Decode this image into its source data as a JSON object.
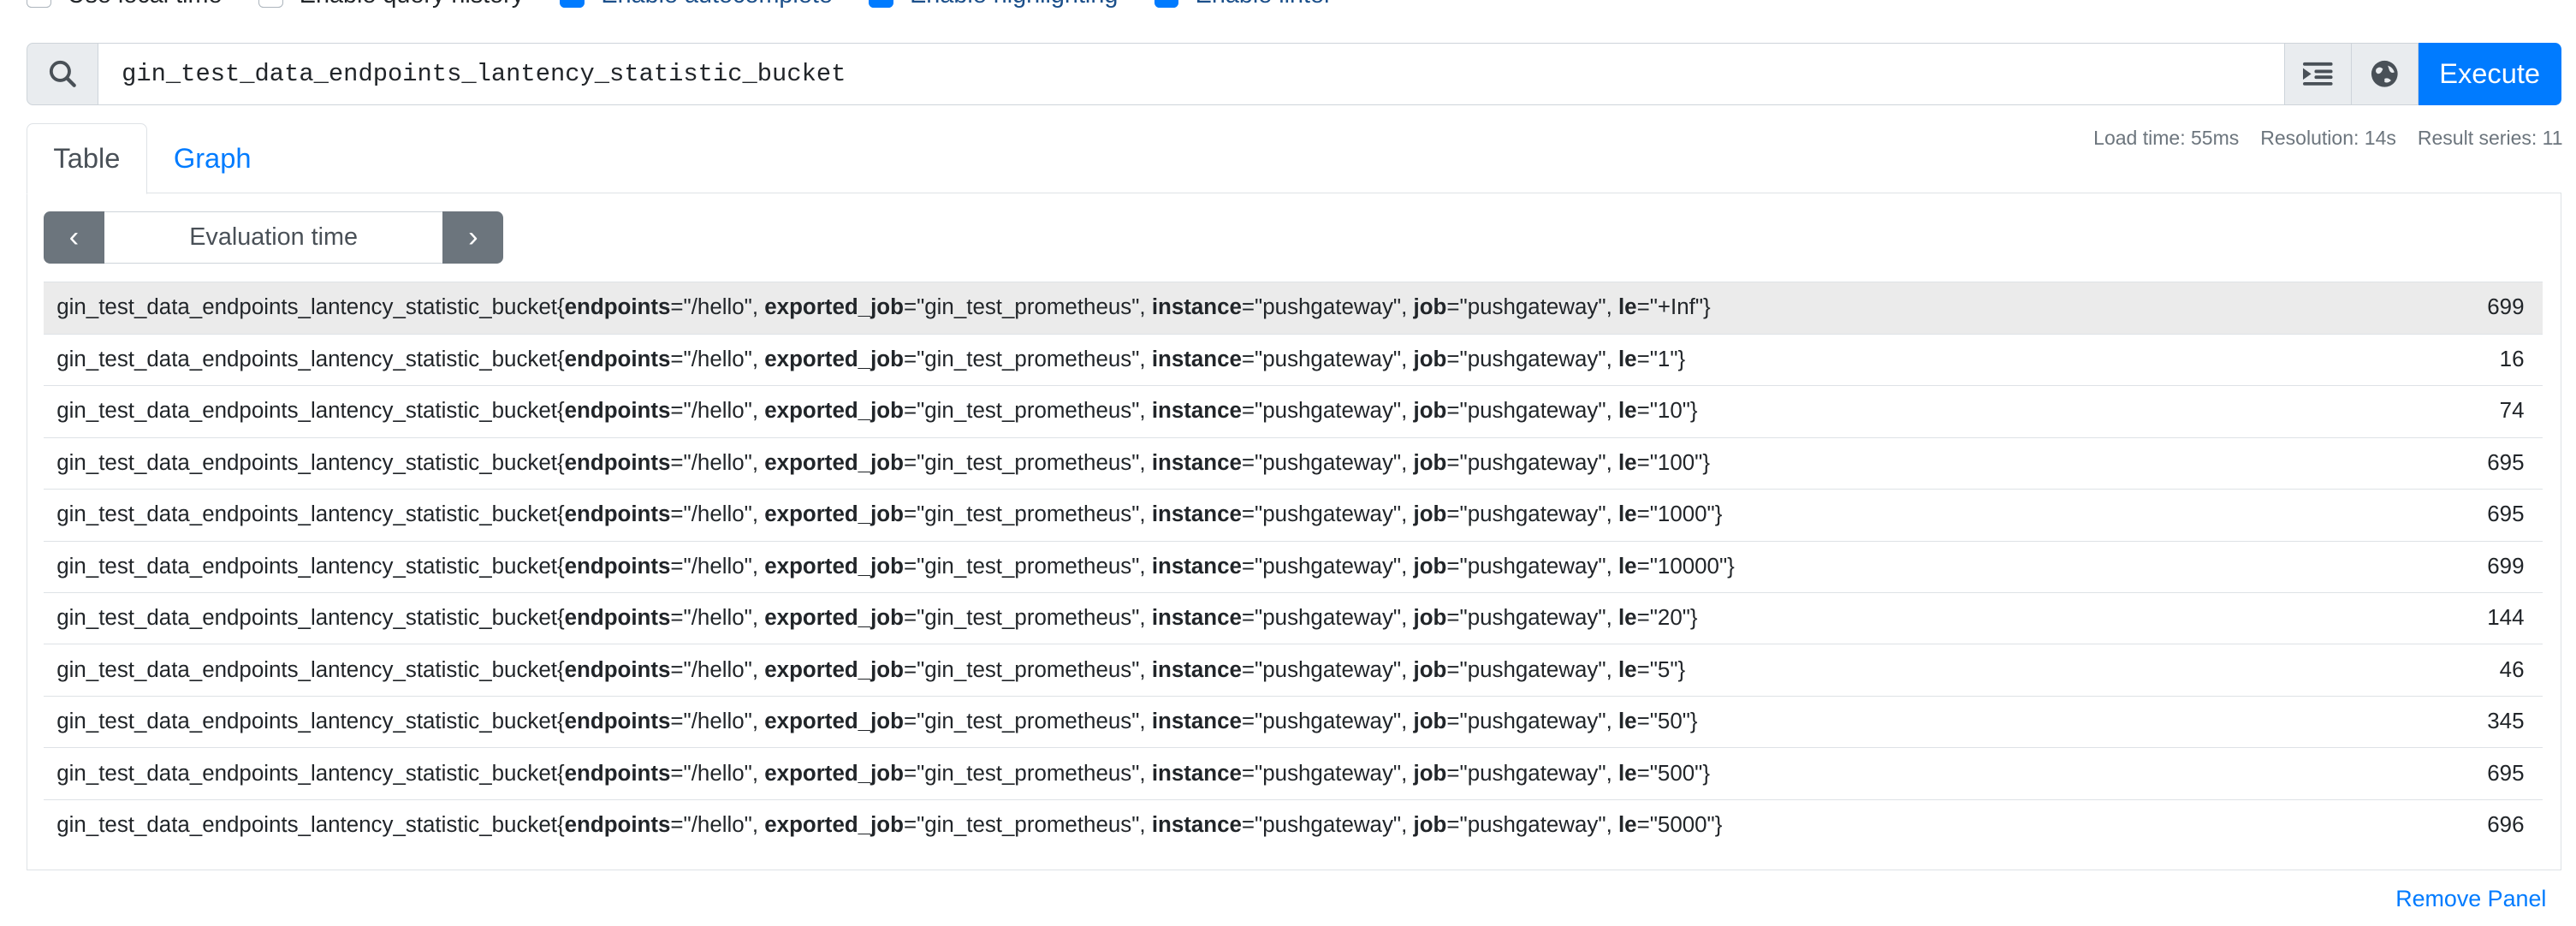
{
  "options": [
    {
      "label": "Use local time",
      "checked": false
    },
    {
      "label": "Enable query history",
      "checked": false
    },
    {
      "label": "Enable autocomplete",
      "checked": true
    },
    {
      "label": "Enable highlighting",
      "checked": true
    },
    {
      "label": "Enable linter",
      "checked": true
    }
  ],
  "search": {
    "query": "gin_test_data_endpoints_lantency_statistic_bucket",
    "icon": "search-icon",
    "execute_label": "Execute"
  },
  "tabs": [
    {
      "label": "Table",
      "active": true
    },
    {
      "label": "Graph",
      "active": false
    }
  ],
  "meta": {
    "load_time": "Load time: 55ms",
    "resolution": "Resolution: 14s",
    "result_series": "Result series: 11"
  },
  "evaluation_time": {
    "placeholder": "Evaluation time"
  },
  "metric": "gin_test_data_endpoints_lantency_statistic_bucket",
  "rows": [
    {
      "le": "+Inf",
      "value": "699"
    },
    {
      "le": "1",
      "value": "16"
    },
    {
      "le": "10",
      "value": "74"
    },
    {
      "le": "100",
      "value": "695"
    },
    {
      "le": "1000",
      "value": "695"
    },
    {
      "le": "10000",
      "value": "699"
    },
    {
      "le": "20",
      "value": "144"
    },
    {
      "le": "5",
      "value": "46"
    },
    {
      "le": "50",
      "value": "345"
    },
    {
      "le": "500",
      "value": "695"
    },
    {
      "le": "5000",
      "value": "696"
    }
  ],
  "labels": {
    "endpoints": "/hello",
    "exported_job": "gin_test_prometheus",
    "instance": "pushgateway",
    "job": "pushgateway"
  },
  "remove_panel": "Remove Panel",
  "colors": {
    "accent": "#007bff",
    "nav": "#6c757d",
    "highlight_row": "#ebebeb"
  }
}
